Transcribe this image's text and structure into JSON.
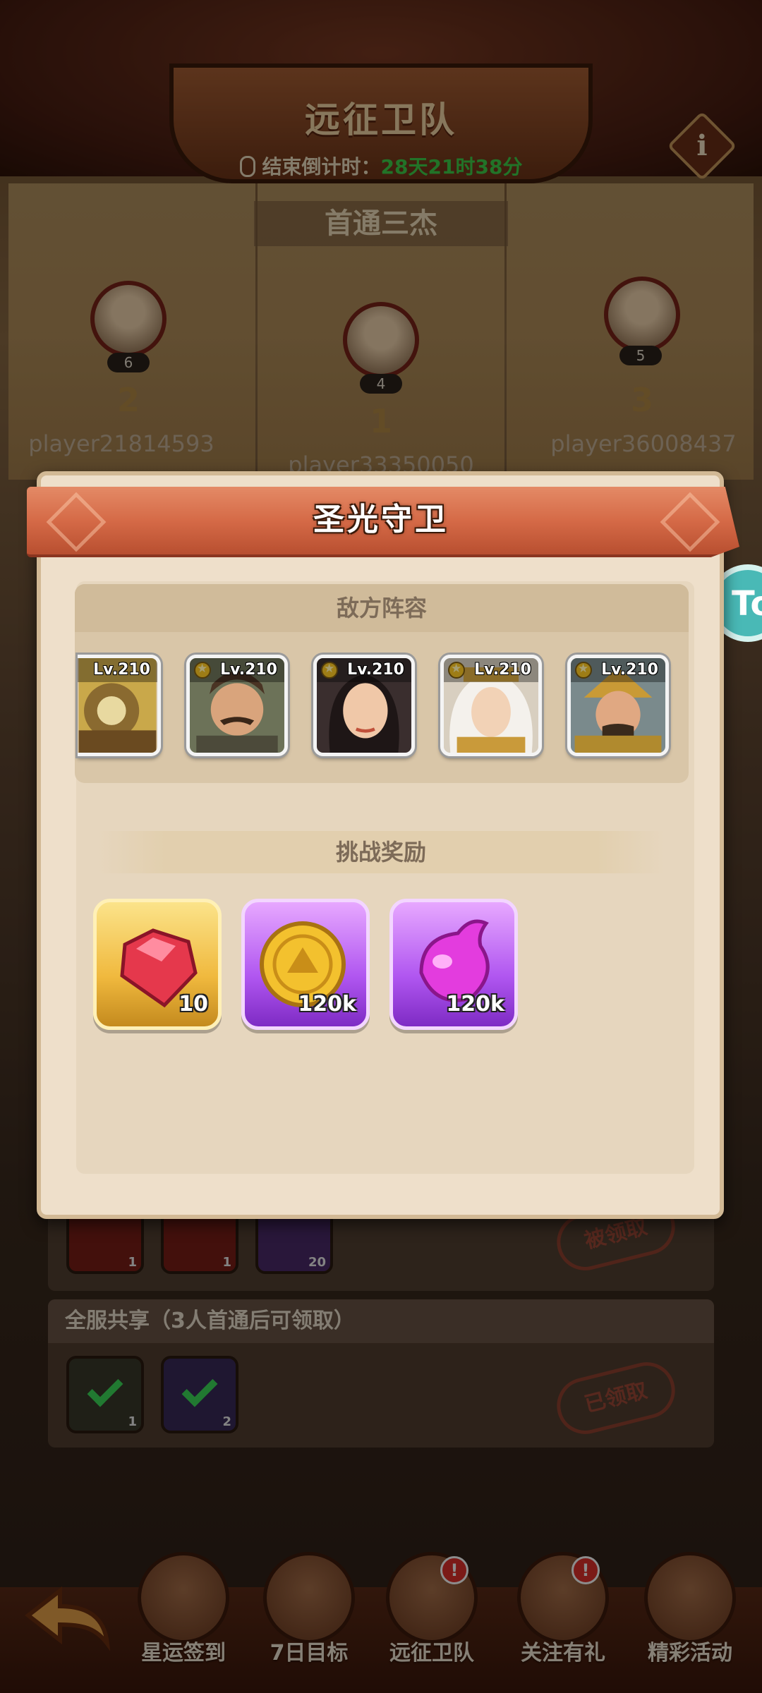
{
  "header": {
    "title": "远征卫队",
    "countdown_label": "结束倒计时：",
    "countdown_value": "28天21时38分",
    "info_label": "i"
  },
  "podium": {
    "title": "首通三杰",
    "entries": [
      {
        "rank": "2",
        "level": "6",
        "name": "player21814593"
      },
      {
        "rank": "1",
        "level": "4",
        "name": "player33350050"
      },
      {
        "rank": "3",
        "level": "5",
        "name": "player36008437"
      }
    ]
  },
  "background_rewards": {
    "panel1_counts": [
      "1",
      "1",
      "20"
    ],
    "panel1_stamp": "被领取",
    "panel2_header": "全服共享（3人首通后可领取）",
    "panel2_counts": [
      "1",
      "2"
    ],
    "panel2_stamp": "已领取"
  },
  "modal": {
    "title": "圣光守卫",
    "enemy_section_title": "敌方阵容",
    "enemies": [
      {
        "level": "Lv.210",
        "icon": "hero-armored-warrior-icon",
        "star": false
      },
      {
        "level": "Lv.210",
        "icon": "hero-mustached-man-icon",
        "star": true
      },
      {
        "level": "Lv.210",
        "icon": "hero-dark-haired-woman-icon",
        "star": true
      },
      {
        "level": "Lv.210",
        "icon": "hero-white-haired-knight-icon",
        "star": true
      },
      {
        "level": "Lv.210",
        "icon": "hero-samurai-icon",
        "star": true
      }
    ],
    "reward_section_title": "挑战奖励",
    "rewards": [
      {
        "icon": "ruby-gem-icon",
        "qty": "10",
        "frame": "gold"
      },
      {
        "icon": "gold-coin-icon",
        "qty": "120k",
        "frame": "purple"
      },
      {
        "icon": "purple-potion-icon",
        "qty": "120k",
        "frame": "purple"
      }
    ]
  },
  "side_float_label": "To",
  "bottom_nav": [
    {
      "label": "星运签到",
      "badge": ""
    },
    {
      "label": "7日目标",
      "badge": ""
    },
    {
      "label": "远征卫队",
      "badge": "!"
    },
    {
      "label": "关注有礼",
      "badge": "!"
    },
    {
      "label": "精彩活动",
      "badge": ""
    }
  ],
  "colors": {
    "ribbon": "#d56a47",
    "countdown_green": "#3fd14a",
    "gold_frame": "#f0b93e",
    "purple_frame": "#b056f0"
  }
}
